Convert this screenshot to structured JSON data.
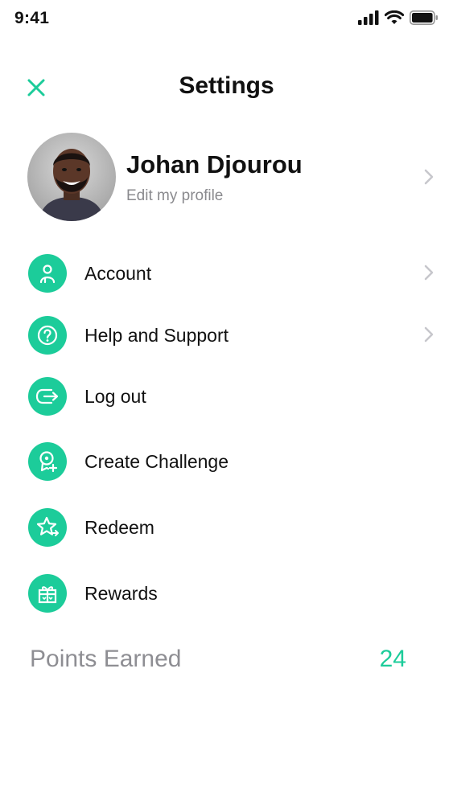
{
  "status_bar": {
    "time": "9:41"
  },
  "header": {
    "title": "Settings"
  },
  "profile": {
    "name": "Johan Djourou",
    "subtitle": "Edit my profile"
  },
  "menu": {
    "items": [
      {
        "label": "Account",
        "icon": "user-icon"
      },
      {
        "label": "Help and Support",
        "icon": "question-icon"
      },
      {
        "label": "Log out",
        "icon": "logout-icon"
      },
      {
        "label": "Create Challenge",
        "icon": "challenge-icon"
      },
      {
        "label": "Redeem",
        "icon": "star-icon"
      },
      {
        "label": "Rewards",
        "icon": "gift-icon"
      }
    ]
  },
  "points": {
    "label": "Points Earned",
    "value": "24"
  },
  "colors": {
    "accent": "#1ccc9a",
    "muted_text": "#8e8e93",
    "chevron": "#c7c7cc"
  }
}
